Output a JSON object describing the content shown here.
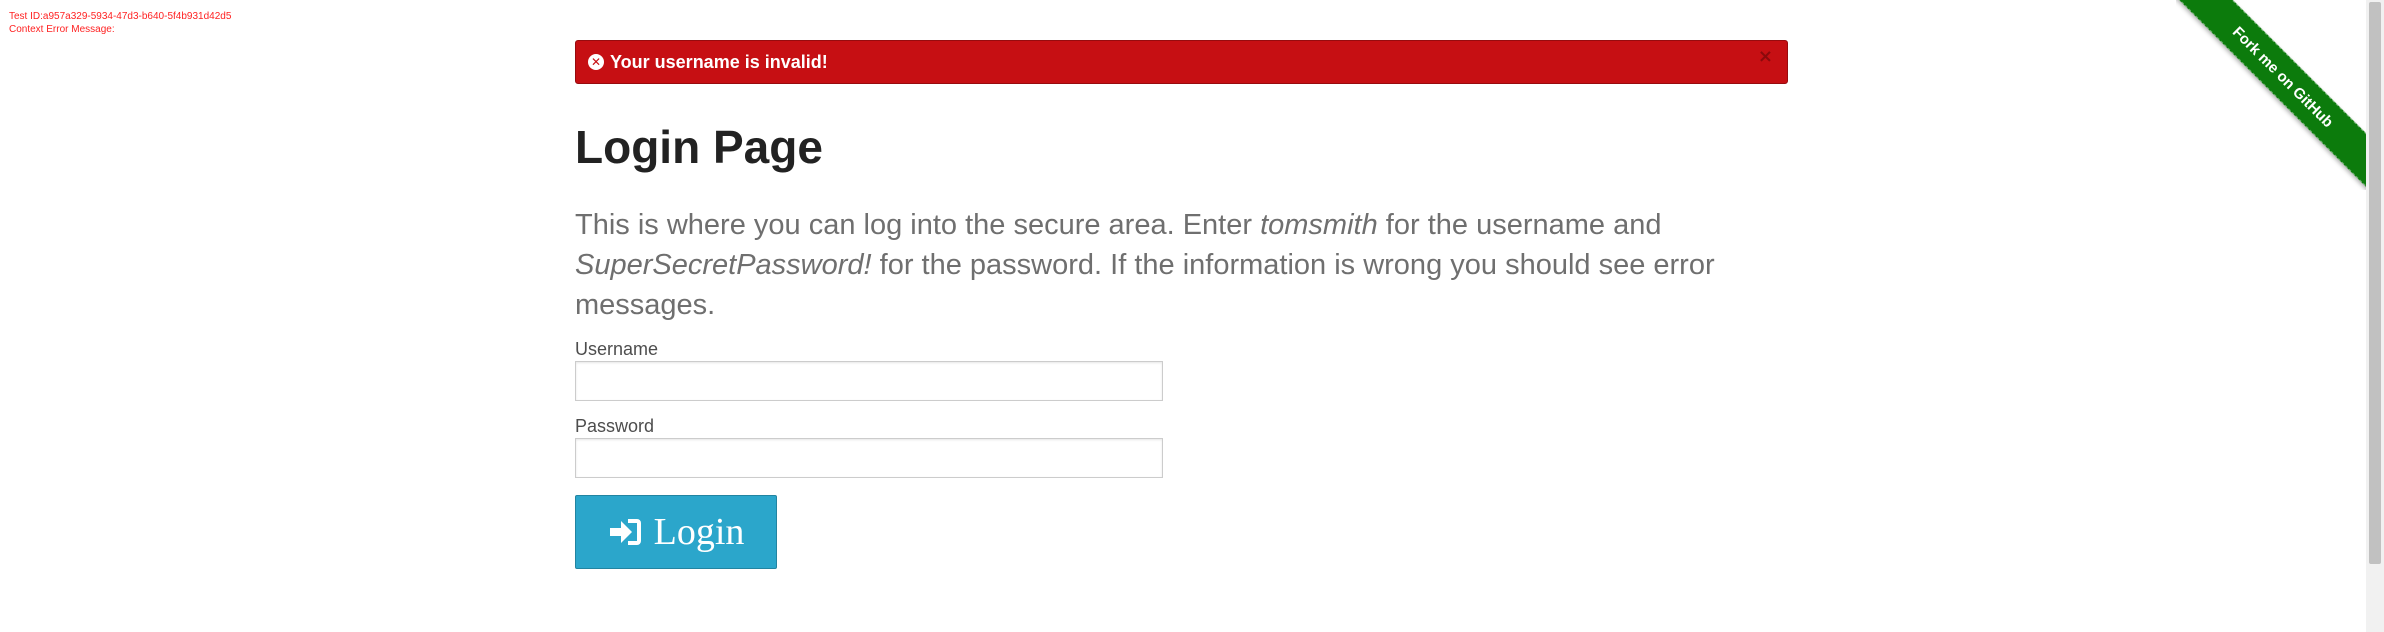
{
  "debug": {
    "test_id": "Test ID:a957a329-5934-47d3-b640-5f4b931d42d5",
    "context": "Context Error Message:"
  },
  "flash": {
    "message": "Your username is invalid!",
    "close": "×",
    "color": "#c60f13"
  },
  "page": {
    "title": "Login Page",
    "description_1": "This is where you can log into the secure area. Enter ",
    "username_hint": "tomsmith",
    "description_2": " for the username and ",
    "password_hint": "SuperSecretPassword!",
    "description_3": " for the password. If the information is wrong you should see error messages."
  },
  "form": {
    "username_label": "Username",
    "username_value": "",
    "password_label": "Password",
    "password_value": "",
    "login_label": "Login",
    "login_icon": "sign-in-icon",
    "button_color": "#2ba6cb"
  },
  "ribbon": {
    "label": "Fork me on GitHub",
    "color": "#0c7b0c"
  }
}
